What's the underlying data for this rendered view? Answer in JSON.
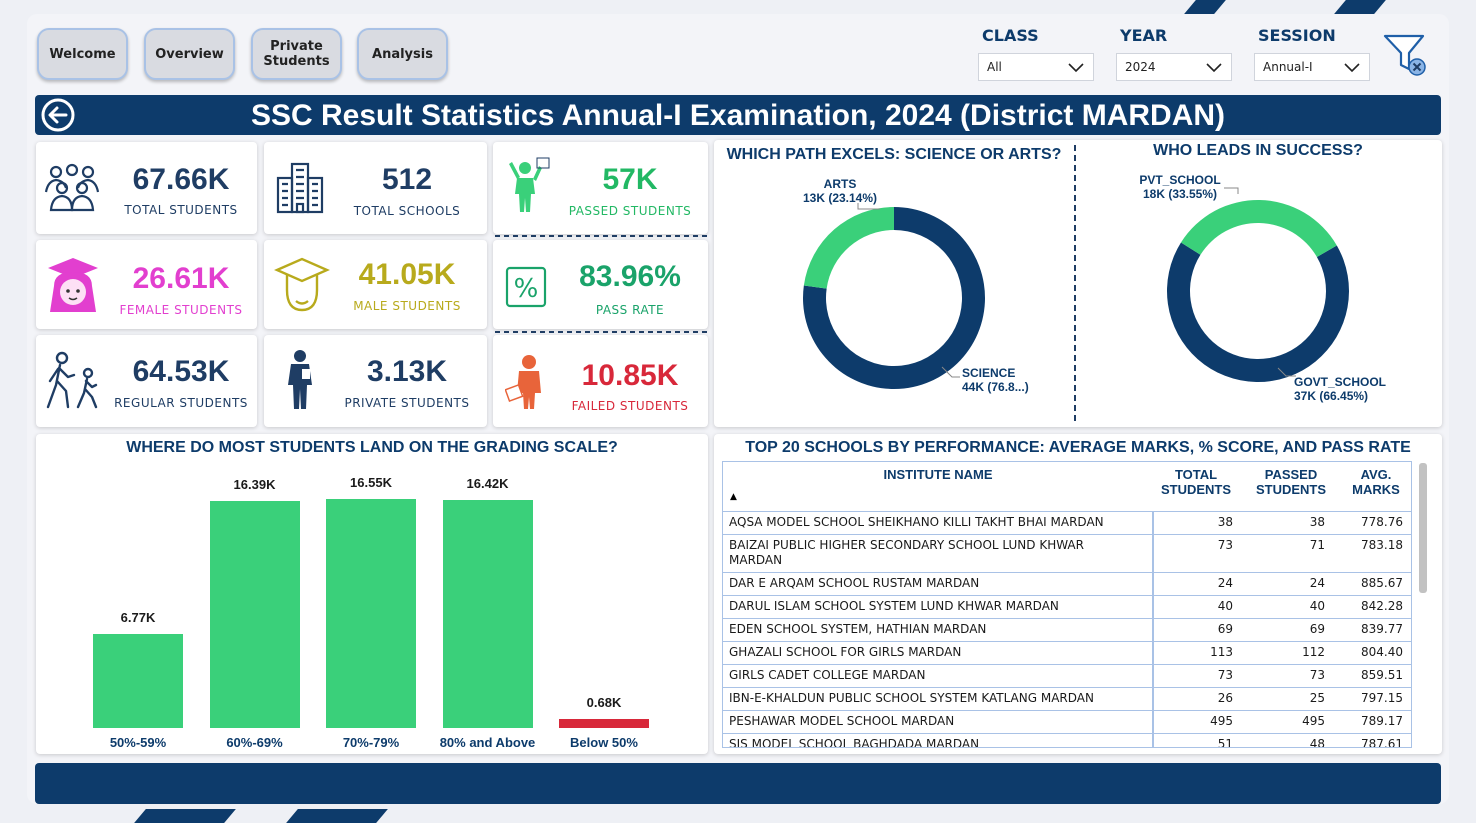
{
  "colors": {
    "navy": "#0d3b6b",
    "green": "#3ad07a",
    "magenta": "#e23fcf",
    "olive": "#b8aa1c",
    "red": "#d8283a",
    "label_blue": "#1f3d64"
  },
  "nav": [
    {
      "label": "Welcome"
    },
    {
      "label": "Overview"
    },
    {
      "label": "Private\nStudents"
    },
    {
      "label": "Analysis"
    }
  ],
  "filters": [
    {
      "label": "CLASS",
      "value": "All"
    },
    {
      "label": "YEAR",
      "value": "2024"
    },
    {
      "label": "SESSION",
      "value": "Annual-I"
    }
  ],
  "title": "SSC Result Statistics Annual-I Examination, 2024 (District MARDAN)",
  "kpis": [
    {
      "value": "67.66K",
      "label": "TOTAL STUDENTS",
      "icon": "group-icon"
    },
    {
      "value": "512",
      "label": "TOTAL SCHOOLS",
      "icon": "buildings-icon"
    },
    {
      "value": "57K",
      "label": "PASSED STUDENTS",
      "icon": "celebrating-student-icon"
    },
    {
      "value": "26.61K",
      "label": "FEMALE STUDENTS",
      "icon": "female-graduate-icon"
    },
    {
      "value": "41.05K",
      "label": "MALE STUDENTS",
      "icon": "male-graduate-icon"
    },
    {
      "value": "83.96%",
      "label": "PASS RATE",
      "icon": "percent-icon"
    },
    {
      "value": "64.53K",
      "label": "REGULAR STUDENTS",
      "icon": "walking-students-icon"
    },
    {
      "value": "3.13K",
      "label": "PRIVATE STUDENTS",
      "icon": "private-student-icon"
    },
    {
      "value": "10.85K",
      "label": "FAILED STUDENTS",
      "icon": "sad-student-icon"
    }
  ],
  "donut_science": {
    "title": "WHICH PATH EXCELS: SCIENCE OR ARTS?",
    "arts_name": "ARTS",
    "arts_value": "13K (23.14%)",
    "science_name": "SCIENCE",
    "science_value": "44K (76.8...)"
  },
  "donut_school": {
    "title": "WHO LEADS IN SUCCESS?",
    "pvt_name": "PVT_SCHOOL",
    "pvt_value": "18K (33.55%)",
    "govt_name": "GOVT_SCHOOL",
    "govt_value": "37K (66.45%)"
  },
  "chart_data": [
    {
      "type": "pie",
      "title": "WHICH PATH EXCELS: SCIENCE OR ARTS?",
      "slices": [
        {
          "name": "ARTS",
          "value": 13,
          "percent": 23.14
        },
        {
          "name": "SCIENCE",
          "value": 44,
          "percent": 76.86
        }
      ]
    },
    {
      "type": "pie",
      "title": "WHO LEADS IN SUCCESS?",
      "slices": [
        {
          "name": "PVT_SCHOOL",
          "value": 18,
          "percent": 33.55
        },
        {
          "name": "GOVT_SCHOOL",
          "value": 37,
          "percent": 66.45
        }
      ]
    },
    {
      "type": "bar",
      "title": "WHERE DO MOST STUDENTS LAND ON THE GRADING SCALE?",
      "categories": [
        "50%-59%",
        "60%-69%",
        "70%-79%",
        "80% and Above",
        "Below 50%"
      ],
      "values": [
        6.77,
        16.39,
        16.55,
        16.42,
        0.68
      ],
      "value_labels": [
        "6.77K",
        "16.39K",
        "16.55K",
        "16.42K",
        "0.68K"
      ],
      "ylim": [
        0,
        16.6
      ]
    }
  ],
  "bar_title": "WHERE DO MOST STUDENTS LAND ON THE GRADING SCALE?",
  "table": {
    "title": "TOP 20 SCHOOLS BY PERFORMANCE: AVERAGE MARKS, % SCORE, AND PASS RATE",
    "headers": [
      "INSTITUTE NAME",
      "TOTAL\nSTUDENTS",
      "PASSED\nSTUDENTS",
      "AVG.\nMARKS"
    ],
    "sort_indicator": "▲",
    "rows": [
      [
        "AQSA MODEL SCHOOL SHEIKHANO KILLI TAKHT BHAI MARDAN",
        "38",
        "38",
        "778.76"
      ],
      [
        "BAIZAI PUBLIC HIGHER SECONDARY SCHOOL LUND KHWAR MARDAN",
        "73",
        "71",
        "783.18"
      ],
      [
        "DAR E ARQAM SCHOOL RUSTAM MARDAN",
        "24",
        "24",
        "885.67"
      ],
      [
        "DARUL ISLAM SCHOOL SYSTEM LUND KHWAR MARDAN",
        "40",
        "40",
        "842.28"
      ],
      [
        "EDEN SCHOOL SYSTEM, HATHIAN MARDAN",
        "69",
        "69",
        "839.77"
      ],
      [
        "GHAZALI SCHOOL FOR GIRLS MARDAN",
        "113",
        "112",
        "804.40"
      ],
      [
        "GIRLS CADET COLLEGE MARDAN",
        "73",
        "73",
        "859.51"
      ],
      [
        "IBN-E-KHALDUN PUBLIC SCHOOL SYSTEM KATLANG MARDAN",
        "26",
        "25",
        "797.15"
      ],
      [
        "PESHAWAR MODEL SCHOOL MARDAN",
        "495",
        "495",
        "789.17"
      ],
      [
        "SIS MODEL SCHOOL BAGHDADA MARDAN",
        "51",
        "48",
        "787.61"
      ]
    ]
  }
}
